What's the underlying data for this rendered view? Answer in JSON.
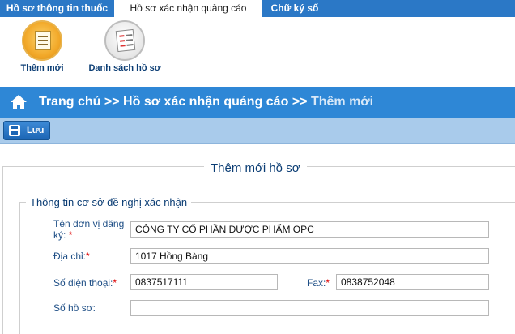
{
  "tabs": [
    {
      "label": "Hồ sơ thông tin thuốc"
    },
    {
      "label": "Hồ sơ xác nhận quảng cáo"
    },
    {
      "label": "Chữ ký số"
    }
  ],
  "ribbon": {
    "add_label": "Thêm mới",
    "list_label": "Danh sách hồ sơ"
  },
  "breadcrumb": {
    "home": "Trang chủ",
    "sep1": ">>",
    "section": "Hồ sơ xác nhận quảng cáo",
    "sep2": ">>",
    "current": "Thêm mới"
  },
  "toolbar": {
    "save_label": "Lưu"
  },
  "form": {
    "title": "Thêm mới hồ sơ",
    "legend": "Thông tin cơ sở đề nghị xác nhận",
    "fields": {
      "unit_name": {
        "label": "Tên đơn vị đăng ký:",
        "required_mark": "*",
        "value": "CÔNG TY CỔ PHẦN DƯỢC PHẨM OPC"
      },
      "address": {
        "label": "Địa chỉ:",
        "required_mark": "*",
        "value": "1017 Hồng Bàng"
      },
      "phone": {
        "label": "Số điện thoại:",
        "required_mark": "*",
        "value": "0837517111"
      },
      "fax": {
        "label": "Fax:",
        "required_mark": "*",
        "value": "0838752048"
      },
      "record_no": {
        "label": "Số hồ sơ:",
        "value": ""
      }
    }
  }
}
